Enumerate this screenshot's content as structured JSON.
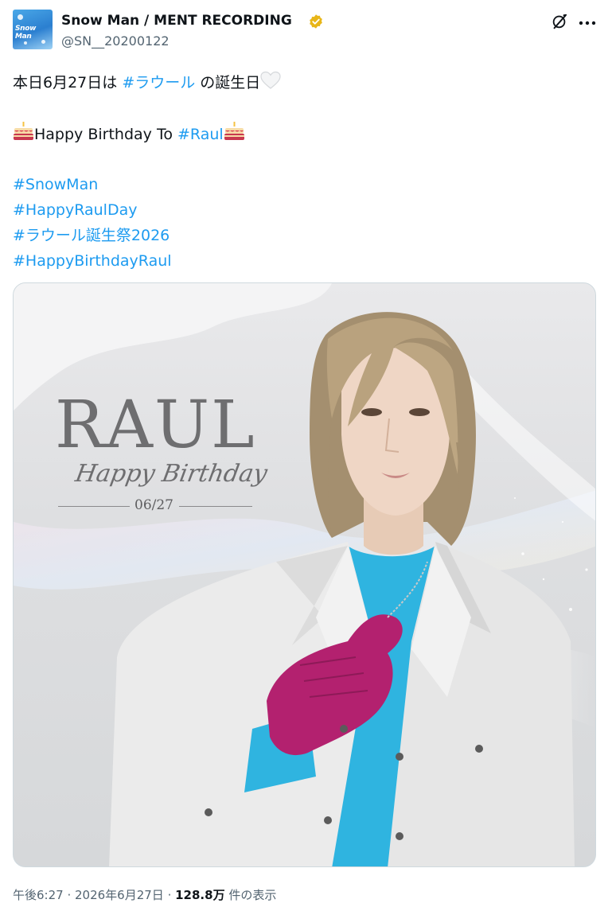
{
  "account": {
    "display_name": "Snow Man / MENT RECORDING",
    "handle": "@SN__20200122",
    "avatar_text": "Snow Man",
    "verified": true,
    "verified_color": "#e8b618"
  },
  "header_icons": [
    "grok-icon",
    "more-icon"
  ],
  "tweet": {
    "line1_pre": "本日6月27日は ",
    "line1_tag": "#ラウール",
    "line1_post": " の誕生日",
    "line1_emoji": "white-heart",
    "line2_text": "Happy Birthday To ",
    "line2_tag": "#Raul",
    "line2_emoji": "cake",
    "hashtags": [
      "#SnowMan",
      "#HappyRaulDay",
      "#ラウール誕生祭2026",
      "#HappyBirthdayRaul"
    ]
  },
  "media": {
    "title": "RAUL",
    "subtitle": "Happy Birthday",
    "date": "06/27"
  },
  "footer": {
    "time": "午後6:27",
    "sep": " · ",
    "date": "2026年6月27日",
    "sep2": " · ",
    "views": "128.8万",
    "views_suffix": " 件の表示"
  },
  "colors": {
    "link": "#1d9bf0",
    "text": "#0f1419",
    "muted": "#536471",
    "glove": "#b3216f",
    "shirt": "#2fb4e0"
  }
}
